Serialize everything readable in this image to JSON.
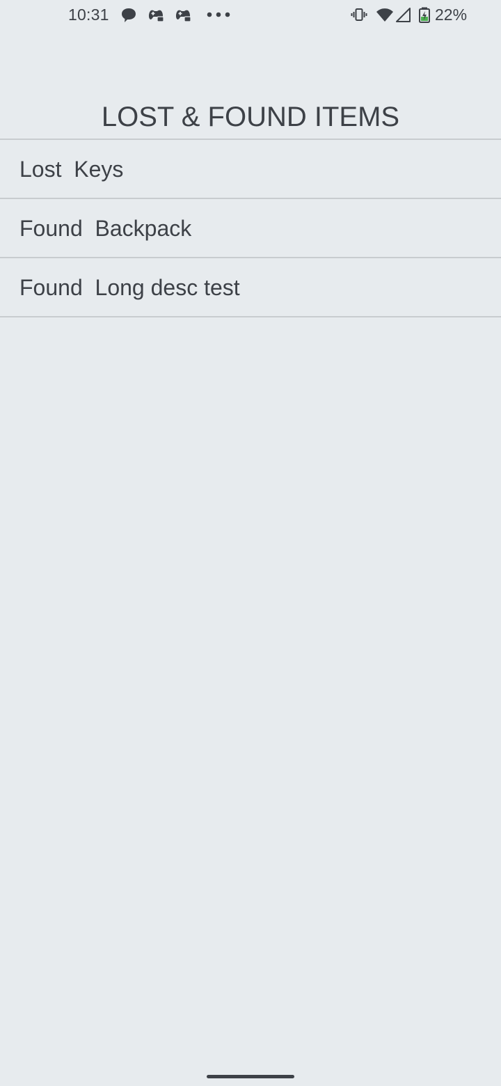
{
  "status_bar": {
    "time": "10:31",
    "battery_percent": "22%",
    "left_icons": [
      "chat-bubble-icon",
      "game-controller-icon",
      "game-controller-icon",
      "more-dots-icon"
    ],
    "right_icons": [
      "vibrate-icon",
      "wifi-icon",
      "cellular-signal-icon",
      "battery-charging-icon"
    ]
  },
  "page": {
    "title": "LOST & FOUND ITEMS"
  },
  "items": [
    {
      "status": "Lost",
      "name": "Keys",
      "label": "Lost  Keys"
    },
    {
      "status": "Found",
      "name": "Backpack",
      "label": "Found  Backpack"
    },
    {
      "status": "Found",
      "name": "Long desc test",
      "label": "Found  Long desc test"
    }
  ],
  "colors": {
    "background": "#e7ebee",
    "text": "#3d4147",
    "divider": "#c8cccf",
    "battery_fill": "#4caf50"
  }
}
